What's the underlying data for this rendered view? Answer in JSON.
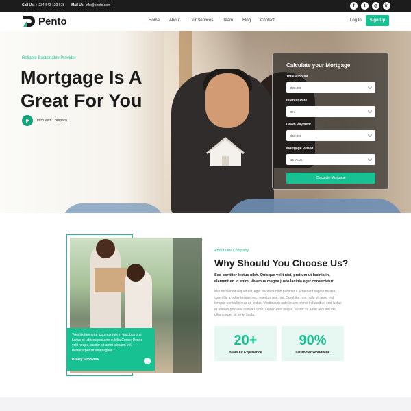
{
  "topbar": {
    "call_label": "Call Us:",
    "call_value": "+ 234-543 123 678",
    "mail_label": "Mail Us:",
    "mail_value": "info@pento.com",
    "socials": [
      "f",
      "t",
      "◎",
      "in"
    ]
  },
  "nav": {
    "brand": "Pento",
    "menu": [
      "Home",
      "About",
      "Our Services",
      "Team",
      "Blog",
      "Contact"
    ],
    "login": "Log In",
    "signup": "Sign Up"
  },
  "hero": {
    "tag": "Reliable Sustainable Provider",
    "title_line1": "Mortgage Is A",
    "title_line2": "Great For You",
    "intro": "Intro With Company"
  },
  "calculator": {
    "title": "Calculate your Mortgage",
    "fields": [
      {
        "label": "Total Amount",
        "value": "$30,000"
      },
      {
        "label": "Interest Rate",
        "value": "9%"
      },
      {
        "label": "Down Payment",
        "value": "$50,000"
      },
      {
        "label": "Mortgage Period",
        "value": "15 Years"
      }
    ],
    "button": "Calculate Mortgage"
  },
  "about": {
    "tag": "About Our Company",
    "title": "Why Should You Choose Us?",
    "lead": "Sed porttitor lectus nibh. Quisque velit nisi, pretium ut lacinia in, elementum id enim. Vivamus magna justo lacinia eget consectetur.",
    "body": "Mauris blandit aliquet elit, eget tincidunt nibh pulvinar a. Praesent sapien massa, convallis a pellentesque nec, egestas non nisi. Curabitur non nulla sit amet nisl tempus convallis quis ac lectus. Vestibulum ante ipsum primis in faucibus orci luctus et ultrices posuere cubilia Curae; Donec velit neque, auctor sit amet aliquam vel, ullamcorper sit amet ligula.",
    "quote": "\"Vestibulum ante ipsum primis in faucibus orci luctus et ultrices posuere cubilia Curae; Donec velit neque, auctor sit amet aliquam vel, ullamcorper sit amet ligula.\"",
    "quote_author": "Brakly Simmons",
    "stats": [
      {
        "number": "20+",
        "caption": "Years Of Experience"
      },
      {
        "number": "90%",
        "caption": "Customer Worldwide"
      }
    ]
  },
  "colors": {
    "accent": "#17c192",
    "dark": "#1c1c1c"
  }
}
